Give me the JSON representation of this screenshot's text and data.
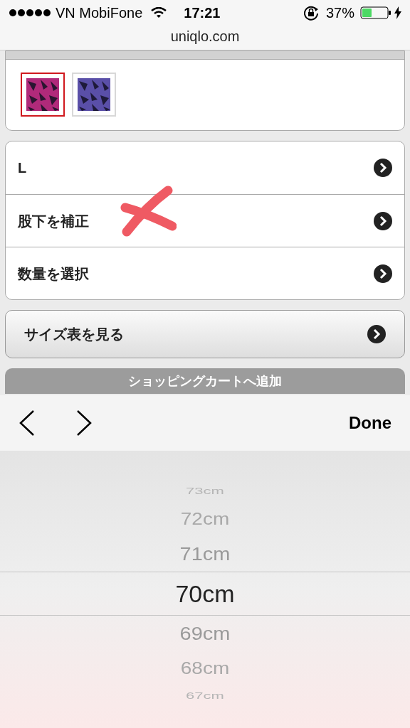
{
  "status_bar": {
    "carrier": "VN MobiFone",
    "time": "17:21",
    "battery": "37%"
  },
  "address_bar": {
    "url": "uniqlo.com"
  },
  "color_swatches": [
    {
      "kind": "picture",
      "selected": true
    },
    {
      "kind": "picture",
      "selected": false
    }
  ],
  "options": [
    {
      "label": "L"
    },
    {
      "label": "股下を補正"
    },
    {
      "label": "数量を選択"
    }
  ],
  "size_chart_button": {
    "label": "サイズ表を見る"
  },
  "cart_button": {
    "label": "ショッピングカートへ追加",
    "disabled": true
  },
  "picker_toolbar": {
    "done": "Done"
  },
  "picker": [
    {
      "label": "73cm",
      "selected": false
    },
    {
      "label": "72cm",
      "selected": false
    },
    {
      "label": "71cm",
      "selected": false
    },
    {
      "label": "70cm",
      "selected": true
    },
    {
      "label": "69cm",
      "selected": false
    },
    {
      "label": "68cm",
      "selected": false
    },
    {
      "label": "67cm",
      "selected": false
    }
  ]
}
